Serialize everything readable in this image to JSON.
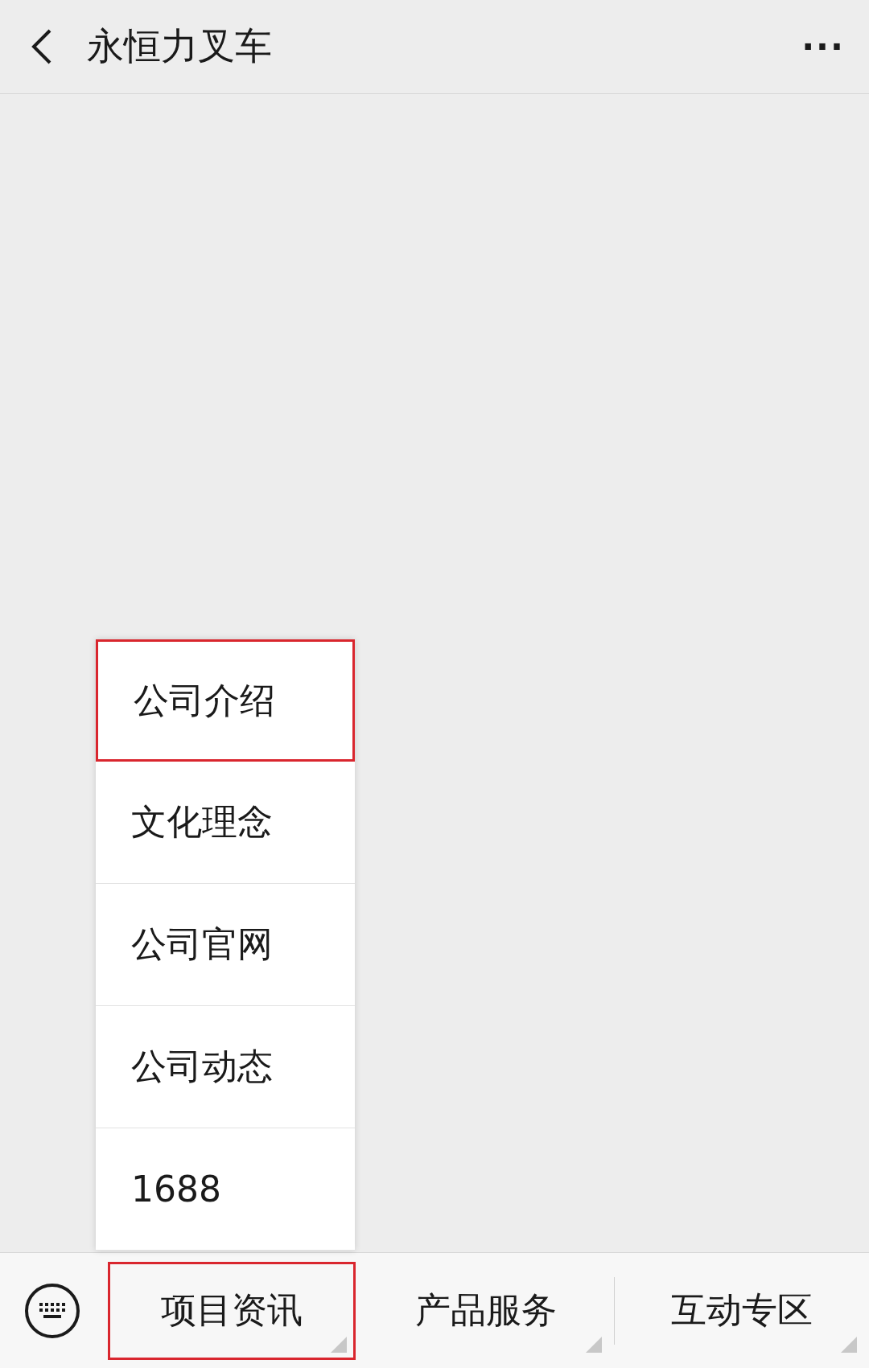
{
  "header": {
    "title": "永恒力叉车",
    "more": "···"
  },
  "submenu": [
    {
      "label": "公司介绍",
      "selected": true
    },
    {
      "label": "文化理念",
      "selected": false
    },
    {
      "label": "公司官网",
      "selected": false
    },
    {
      "label": "公司动态",
      "selected": false
    },
    {
      "label": "1688",
      "selected": false
    }
  ],
  "menu_bar": [
    {
      "label": "项目资讯",
      "selected": true
    },
    {
      "label": "产品服务",
      "selected": false
    },
    {
      "label": "互动专区",
      "selected": false
    }
  ]
}
